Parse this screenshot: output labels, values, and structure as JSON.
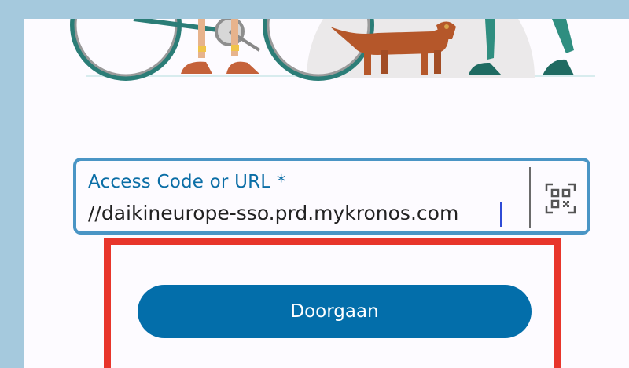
{
  "login": {
    "field_label": "Access Code or URL *",
    "field_value": "//daikineurope-sso.prd.mykronos.com",
    "continue_label": "Doorgaan"
  },
  "icons": {
    "scan": "qr-code-scan-icon"
  },
  "colors": {
    "accent": "#036eaa",
    "field_border": "#4a95c5",
    "label": "#0b6ea6",
    "highlight": "#e8352b",
    "outer_background": "#a5c9dd",
    "panel_background": "#fdfbff"
  }
}
